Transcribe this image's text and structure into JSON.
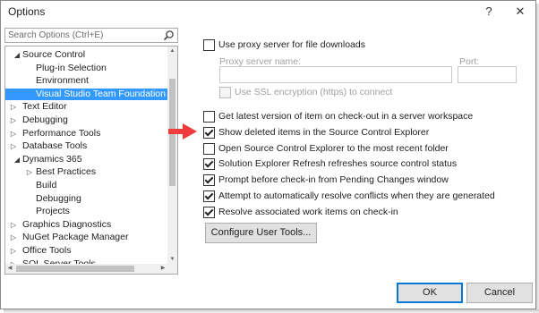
{
  "window": {
    "title": "Options",
    "help_glyph": "?",
    "close_glyph": "✕"
  },
  "search": {
    "placeholder": "Search Options (Ctrl+E)"
  },
  "tree": {
    "items": [
      {
        "label": "Source Control",
        "expanded": true
      },
      {
        "label": "Plug-in Selection"
      },
      {
        "label": "Environment"
      },
      {
        "label": "Visual Studio Team Foundation Se",
        "selected": true
      },
      {
        "label": "Text Editor",
        "expanded": false
      },
      {
        "label": "Debugging",
        "expanded": false
      },
      {
        "label": "Performance Tools",
        "expanded": false
      },
      {
        "label": "Database Tools",
        "expanded": false
      },
      {
        "label": "Dynamics 365",
        "expanded": true
      },
      {
        "label": "Best Practices",
        "expanded": false
      },
      {
        "label": "Build"
      },
      {
        "label": "Debugging"
      },
      {
        "label": "Projects"
      },
      {
        "label": "Graphics Diagnostics",
        "expanded": false
      },
      {
        "label": "NuGet Package Manager",
        "expanded": false
      },
      {
        "label": "Office Tools",
        "expanded": false
      },
      {
        "label": "SQL Server Tools",
        "expanded": false
      }
    ]
  },
  "proxy": {
    "use_proxy_label": "Use proxy server for file downloads",
    "use_proxy_checked": false,
    "server_name_label": "Proxy server name:",
    "port_label": "Port:",
    "ssl_label": "Use SSL encryption (https) to connect",
    "ssl_checked": false
  },
  "options": [
    {
      "label": "Get latest version of item on check-out in a server workspace",
      "checked": false
    },
    {
      "label": "Show deleted items in the Source Control Explorer",
      "checked": true
    },
    {
      "label": "Open Source Control Explorer to the most recent folder",
      "checked": false
    },
    {
      "label": "Solution Explorer Refresh refreshes source control status",
      "checked": true
    },
    {
      "label": "Prompt before check-in from Pending Changes window",
      "checked": true
    },
    {
      "label": "Attempt to automatically resolve conflicts when they are generated",
      "checked": true
    },
    {
      "label": "Resolve associated work items on check-in",
      "checked": true
    }
  ],
  "buttons": {
    "configure_user_tools": "Configure User Tools...",
    "ok": "OK",
    "cancel": "Cancel"
  },
  "colors": {
    "selection": "#3399ff",
    "accent_border": "#0078d7",
    "annotation_arrow": "#ef3d3d"
  }
}
